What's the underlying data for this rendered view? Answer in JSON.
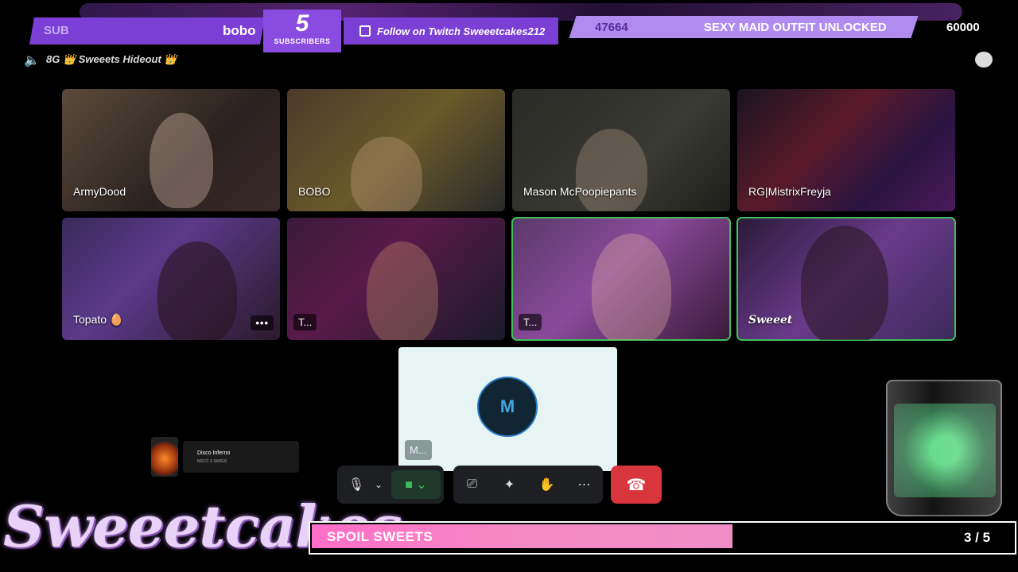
{
  "overlay": {
    "sub_label": "SUB",
    "latest_sub": "bobo",
    "subscriber_count": "5",
    "subscriber_label": "SUBSCRIBERS",
    "follow_text": "Follow on Twitch Sweeetcakes212",
    "goal_current": "47664",
    "goal_title": "SEXY MAID OUTFIT UNLOCKED",
    "goal_target": "60000"
  },
  "header": {
    "channel_name": "8G 👑 Sweeets Hideout 👑"
  },
  "tiles": [
    {
      "name": "ArmyDood",
      "active": false
    },
    {
      "name": "BOBO",
      "active": false
    },
    {
      "name": "Mason McPoopiepants",
      "active": false
    },
    {
      "name": "RG|MistrixFreyja",
      "active": false
    },
    {
      "name": "Topato 🥚",
      "active": false,
      "more": "•••"
    },
    {
      "name": "T...",
      "active": false
    },
    {
      "name": "T...",
      "active": true
    },
    {
      "name": "Sweeet",
      "active": true
    }
  ],
  "placeholder": {
    "avatar_text": "M",
    "chip": "M..."
  },
  "music": {
    "title": "Disco Inferno",
    "artist": "NSCO X SWIGS"
  },
  "controls": {
    "mic_icon": "mic-icon",
    "camera_icon": "camera-icon",
    "end_call_icon": "phone-hangup-icon"
  },
  "brand": {
    "name": "Sweeetcakes"
  },
  "spoil_goal": {
    "title": "SPOIL SWEETS",
    "progress": "3 / 5",
    "fraction": 0.6
  },
  "colors": {
    "accent_purple": "#7b3fd6",
    "active_outline": "#3fbf5c",
    "end_call": "#d8353c",
    "goal_pink": "#ff6ec7"
  }
}
